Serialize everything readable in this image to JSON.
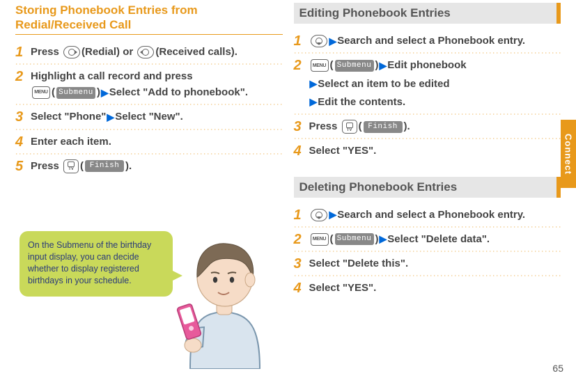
{
  "page_number": "65",
  "side_tab": "Connect",
  "left": {
    "title": "Storing Phonebook Entries from Redial/Received Call",
    "steps": {
      "s1a": "Press ",
      "s1b": "(Redial) or ",
      "s1c": "(Received calls).",
      "s2a": "Highlight a call record and press ",
      "s2b": "Select \"Add to phonebook\".",
      "s3a": "Select \"Phone\"",
      "s3b": "Select \"New\".",
      "s4": "Enter each item.",
      "s5a": "Press ",
      "s5b": "."
    }
  },
  "bubble": "On the Submenu of the birthday input display, you can decide whether to display registered birthdays in your schedule.",
  "labels": {
    "submenu": "Submenu",
    "finish": "Finish",
    "menu": "MENU",
    "paren_open": "(",
    "paren_close": ")"
  },
  "right_edit": {
    "title": "Editing Phonebook Entries",
    "s1a": "Search and select a Phonebook entry.",
    "s2a": "Edit phonebook",
    "s2b": "Select an item to be edited",
    "s2c": "Edit the contents.",
    "s3a": "Press ",
    "s3b": ".",
    "s4": "Select \"YES\"."
  },
  "right_delete": {
    "title": "Deleting Phonebook Entries",
    "s1a": "Search and select a Phonebook entry.",
    "s2a": "Select \"Delete data\".",
    "s3": "Select \"Delete this\".",
    "s4": "Select \"YES\"."
  }
}
